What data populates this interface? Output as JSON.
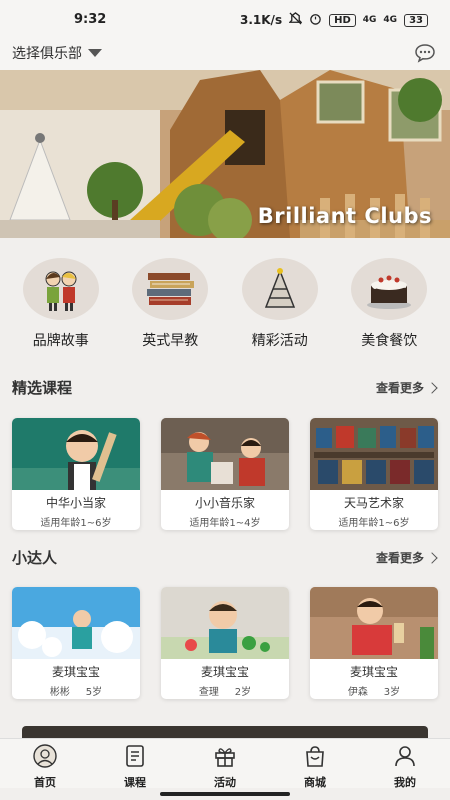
{
  "status_bar": {
    "time": "9:32",
    "speed": "3.1K/s",
    "hd": "HD",
    "net1": "4G",
    "net2": "4G",
    "battery": "33"
  },
  "topbar": {
    "club_select": "选择俱乐部",
    "chat_icon": "chat-bubble-icon"
  },
  "banner": {
    "text": "Brilliant Clubs"
  },
  "categories": [
    {
      "label": "品牌故事",
      "icon": "children-illustration-icon"
    },
    {
      "label": "英式早教",
      "icon": "books-icon"
    },
    {
      "label": "精彩活动",
      "icon": "party-hat-icon"
    },
    {
      "label": "美食餐饮",
      "icon": "cake-icon"
    }
  ],
  "featured": {
    "title": "精选课程",
    "more": "查看更多",
    "items": [
      {
        "title": "中华小当家",
        "sub": "适用年龄1~6岁"
      },
      {
        "title": "小小音乐家",
        "sub": "适用年龄1~4岁"
      },
      {
        "title": "天马艺术家",
        "sub": "适用年龄1~6岁"
      }
    ]
  },
  "stars": {
    "title": "小达人",
    "more": "查看更多",
    "items": [
      {
        "title": "麦琪宝宝",
        "name": "彬彬",
        "age": "5岁"
      },
      {
        "title": "麦琪宝宝",
        "name": "查理",
        "age": "2岁"
      },
      {
        "title": "麦琪宝宝",
        "name": "伊森",
        "age": "3岁"
      }
    ]
  },
  "tabs": [
    {
      "label": "首页",
      "icon": "home-avatar-icon"
    },
    {
      "label": "课程",
      "icon": "document-icon"
    },
    {
      "label": "活动",
      "icon": "gift-icon"
    },
    {
      "label": "商城",
      "icon": "shopping-bag-icon"
    },
    {
      "label": "我的",
      "icon": "person-icon"
    }
  ],
  "colors": {
    "background": "#f1efed",
    "banner_wood": "#8a5a2c",
    "banner_green": "#4f7a2e"
  }
}
